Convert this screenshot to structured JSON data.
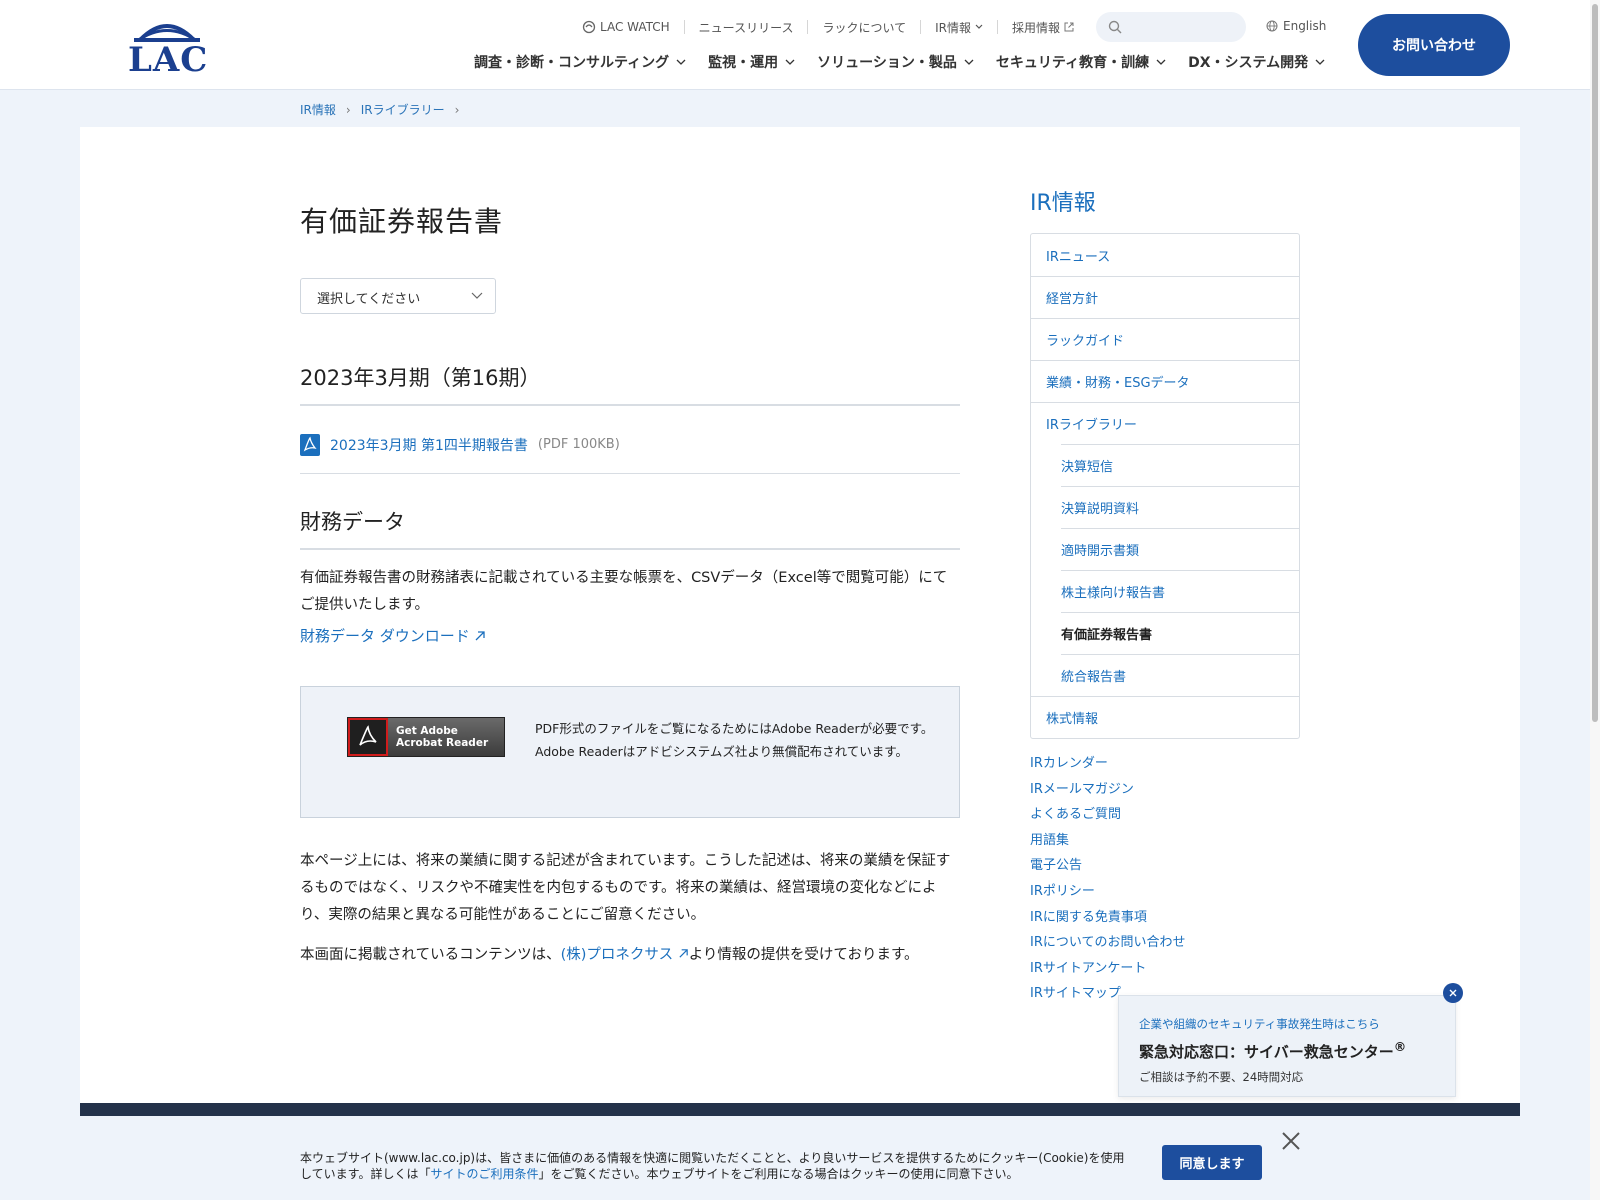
{
  "brand": {
    "logo_text": "LAC",
    "accent": "#1d4e9e",
    "link_color": "#1b6fbd"
  },
  "topnav": [
    {
      "label": "LAC WATCH"
    },
    {
      "label": "ニュースリリース"
    },
    {
      "label": "ラックについて"
    },
    {
      "label": "IR情報"
    },
    {
      "label": "採用情報"
    }
  ],
  "language": "English",
  "contact_button": "お問い合わせ",
  "mainnav": [
    "調査・診断・コンサルティング",
    "監視・運用",
    "ソリューション・製品",
    "セキュリティ教育・訓練",
    "DX・システム開発"
  ],
  "breadcrumb": [
    "IR情報",
    "IRライブラリー"
  ],
  "page": {
    "title": "有価証券報告書",
    "select_label": "選択してください",
    "section1_title": "2023年3月期（第16期）",
    "pdf_link": "2023年3月期 第1四半期報告書",
    "pdf_size": "(PDF 100KB)",
    "section2_title": "財務データ",
    "fin_para": "有価証券報告書の財務諸表に記載されている主要な帳票を、CSVデータ（Excel等で閲覧可能）にてご提供いたします。",
    "download_link": "財務データ ダウンロード",
    "adobe_badge_line1": "Get Adobe",
    "adobe_badge_line2": "Acrobat Reader",
    "adobe_desc": "PDF形式のファイルをご覧になるためにはAdobe Readerが必要です。Adobe Readerはアドビシステムズ社より無償配布されています。",
    "disclaimer": "本ページ上には、将来の業績に関する記述が含まれています。こうした記述は、将来の業績を保証するものではなく、リスクや不確実性を内包するものです。将来の業績は、経営環境の変化などにより、実際の結果と異なる可能性があることにご留意ください。",
    "source_prefix": "本画面に掲載されているコンテンツは、",
    "source_link": "(株)プロネクサス",
    "source_suffix": "より情報の提供を受けております。"
  },
  "sidebar": {
    "title": "IR情報",
    "items": [
      {
        "label": "IRニュース"
      },
      {
        "label": "経営方針"
      },
      {
        "label": "ラックガイド"
      },
      {
        "label": "業績・財務・ESGデータ"
      },
      {
        "label": "IRライブラリー"
      },
      {
        "label": "決算短信"
      },
      {
        "label": "決算説明資料"
      },
      {
        "label": "適時開示書類"
      },
      {
        "label": "株主様向け報告書"
      },
      {
        "label": "有価証券報告書"
      },
      {
        "label": "統合報告書"
      },
      {
        "label": "株式情報"
      }
    ],
    "links": [
      "IRカレンダー",
      "IRメールマガジン",
      "よくあるご質問",
      "用語集",
      "電子公告",
      "IRポリシー",
      "IRに関する免責事項",
      "IRについてのお問い合わせ",
      "IRサイトアンケート",
      "IRサイトマップ"
    ]
  },
  "popup": {
    "line1": "企業や組織のセキュリティ事故発生時はこちら",
    "line2": "緊急対応窓口：サイバー救急センター",
    "line2_mark": "®",
    "line3": "ご相談は予約不要、24時間対応"
  },
  "cookie": {
    "text_a": "本ウェブサイト(www.lac.co.jp)は、皆さまに価値のある情報を快適に閲覧いただくことと、より良いサービスを提供するためにクッキー(Cookie)を使用しています。詳しくは「",
    "link": "サイトのご利用条件",
    "text_b": "」をご覧ください。本ウェブサイトをご利用になる場合はクッキーの使用に同意下さい。",
    "accept": "同意します"
  }
}
